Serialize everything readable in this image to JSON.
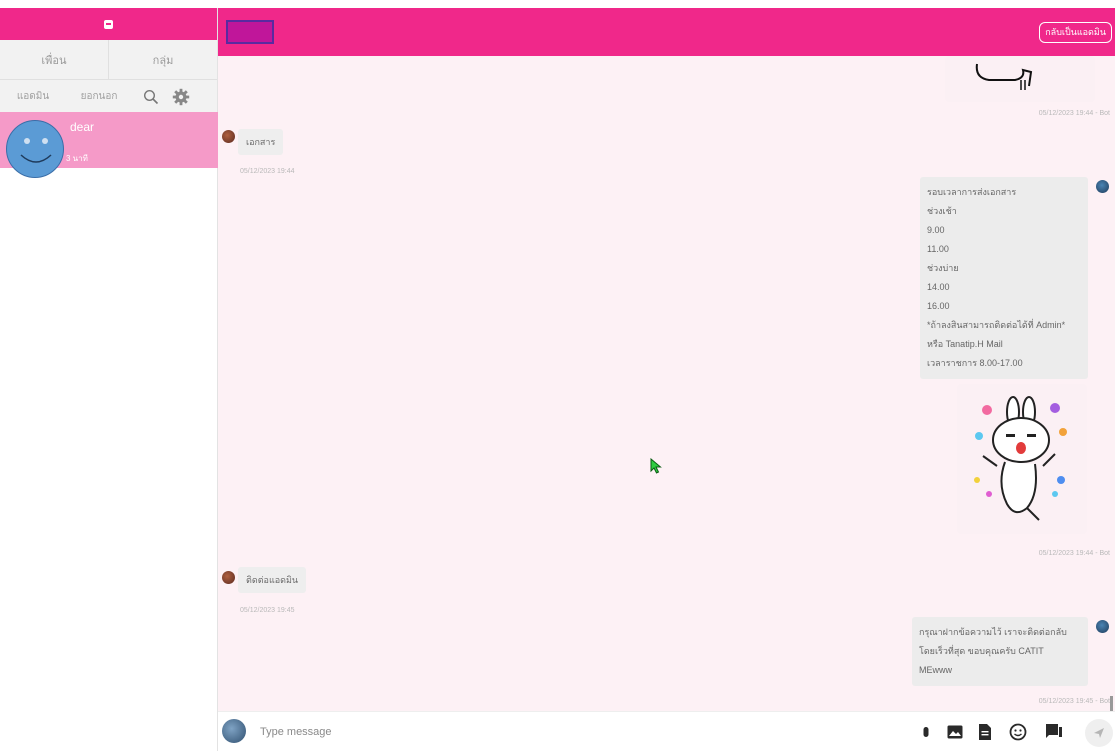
{
  "sidebar": {
    "tabs": {
      "friends": "เพื่อน",
      "groups": "กลุ่ม"
    },
    "subtabs": {
      "admin": "แอดมิน",
      "outside": "ยอกนอก"
    },
    "contact": {
      "name": "dear",
      "preview": "",
      "time": "3 นาที"
    }
  },
  "header": {
    "back_to_admin": "กลับเป็นแอดมิน"
  },
  "messages": [
    {
      "side": "in",
      "text": "เอกสาร",
      "time": "05/12/2023 19:44"
    },
    {
      "side": "out",
      "lines": [
        "รอบเวลาการส่งเอกสาร",
        "ช่วงเช้า",
        "9.00",
        "11.00",
        "ช่วงบ่าย",
        "14.00",
        "16.00",
        "*ถ้าลงสินสามารถติดต่อได้ที่ Admin*",
        "หรือ Tanatip.H Mail",
        "เวลาราชการ 8.00-17.00"
      ]
    },
    {
      "side": "in",
      "text": "ติดต่อแอดมิน",
      "time": "05/12/2023 19:45"
    },
    {
      "side": "out",
      "lines": [
        "กรุณาฝากข้อความไว้ เราจะติดต่อกลับ",
        "โดยเร็วที่สุด ขอบคุณครับ CATIT",
        "MEwww"
      ]
    }
  ],
  "meta": {
    "top_sticker": "05/12/2023 19:44 - Bot",
    "bunny_sticker": "05/12/2023 19:44 - Bot",
    "last_out": "05/12/2023 19:45 - Bot"
  },
  "input": {
    "placeholder": "Type message"
  },
  "colors": {
    "brand": "#f0288a",
    "contact_highlight": "#f59ac8",
    "chat_bg": "#fdf1f5"
  }
}
